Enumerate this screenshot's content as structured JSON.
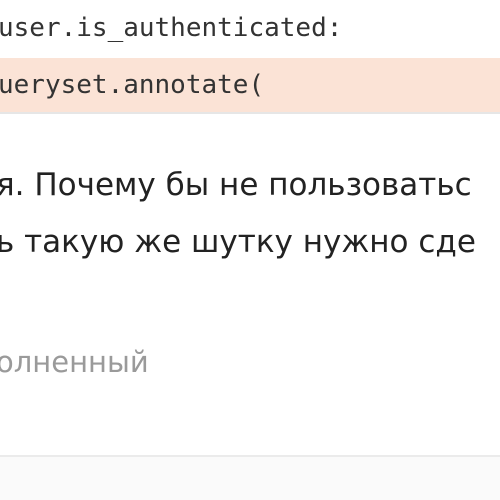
{
  "code": {
    "line_1": "user.is_authenticated:",
    "line_2": "ueryset.annotate(",
    "line_2_highlight_color": "#fbe3d6"
  },
  "post": {
    "line_1": "я. Почему бы не пользоватьс",
    "line_2": "ь такую же шутку нужно сде"
  },
  "status": {
    "label": "олненный"
  }
}
